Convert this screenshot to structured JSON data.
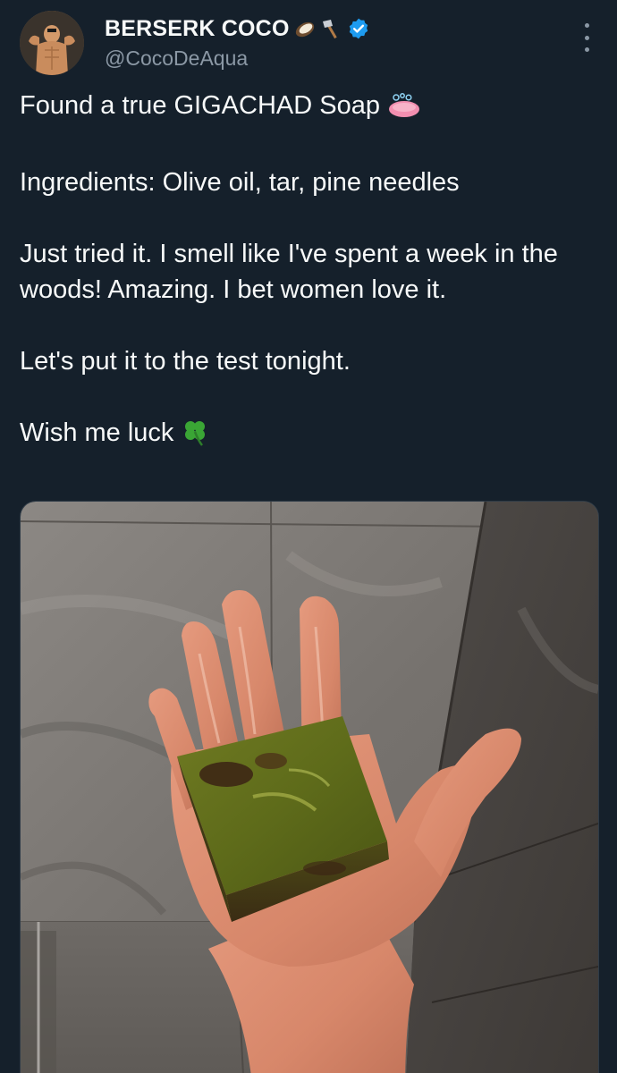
{
  "tweet": {
    "author": {
      "display_name": "BERSERK COCO",
      "handle": "@CocoDeAqua",
      "name_emojis": [
        "coconut-emoji",
        "axe-emoji"
      ],
      "verified": true,
      "verified_color": "#1d9bf0"
    },
    "text": {
      "line1": "Found a true GIGACHAD Soap",
      "line1_emoji": "soap-emoji",
      "line2": "Ingredients: Olive oil, tar, pine needles",
      "line3": "Just tried it. I smell like I've spent a week in the woods! Amazing. I bet women love it.",
      "line4": "Let's put it to the test tonight.",
      "line5": "Wish me luck",
      "line5_emoji": "four-leaf-clover-emoji"
    },
    "media": {
      "kind": "photo",
      "subject": "hand-holding-green-soap-bar"
    }
  },
  "colors": {
    "background": "#15202b",
    "text_primary": "#f7f9f9",
    "text_secondary": "#8b98a5",
    "accent": "#1d9bf0"
  }
}
